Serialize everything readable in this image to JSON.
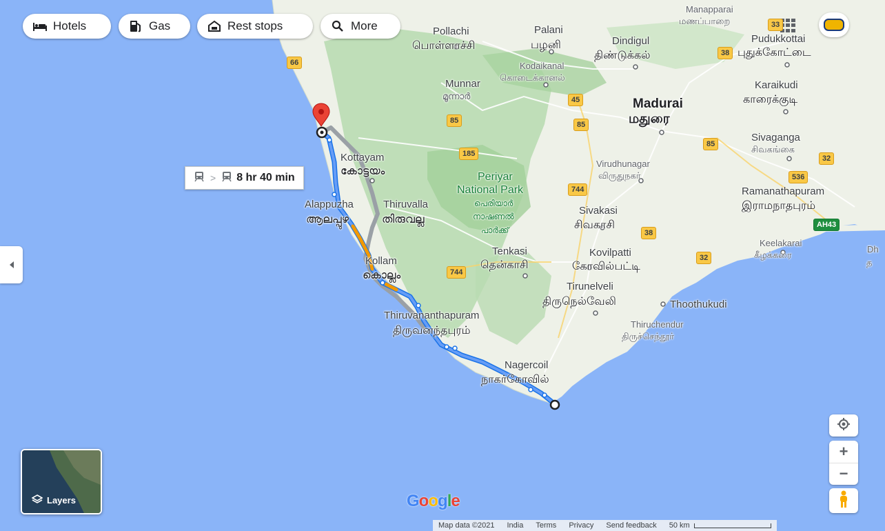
{
  "filters": {
    "hotels": "Hotels",
    "gas": "Gas",
    "rest_stops": "Rest stops",
    "more": "More"
  },
  "route": {
    "travel_time": "8 hr 40 min",
    "mode_icon": "train-icon"
  },
  "places": {
    "manapparai_en": "Manapparai",
    "manapparai_ta": "மணப்பாறை",
    "pollachi_en": "Pollachi",
    "pollachi_ta": "பொள்ளாச்சி",
    "palani_en": "Palani",
    "palani_ta": "பழனி",
    "dindigul_en": "Dindigul",
    "dindigul_ta": "திண்டுக்கல்",
    "pudukkottai_en": "Pudukkottai",
    "pudukkottai_ta": "புதுக்கோட்டை",
    "kodaikanal_en": "Kodaikanal",
    "kodaikanal_ta": "கொடைக்கானல்",
    "munnar_en": "Munnar",
    "munnar_ml": "മൂന്നാർ",
    "karaikudi_en": "Karaikudi",
    "karaikudi_ta": "காரைக்குடி",
    "madurai_en": "Madurai",
    "madurai_ta": "மதுரை",
    "sivaganga_en": "Sivaganga",
    "sivaganga_ta": "சிவகங்கை",
    "kottayam_en": "Kottayam",
    "kottayam_ml": "കോട്ടയം",
    "periyar_en": "Periyar",
    "national_park_en": "National Park",
    "periyar_ml1": "പെരിയാർ",
    "periyar_ml2": "നാഷണൽ",
    "periyar_ml3": "പാർക്ക്",
    "virudhunagar_en": "Virudhunagar",
    "virudhunagar_ta": "விருதுநகர்",
    "ramanathapuram_en": "Ramanathapuram",
    "ramanathapuram_ta": "இராமநாதபுரம்",
    "alappuzha_en": "Alappuzha",
    "alappuzha_ml": "ആലപ്പുഴ",
    "thiruvalla_en": "Thiruvalla",
    "thiruvalla_ml": "തിരുവല്ല",
    "sivakasi_en": "Sivakasi",
    "sivakasi_ta": "சிவகாசி",
    "tenkasi_en": "Tenkasi",
    "tenkasi_ta": "தென்காசி",
    "kovilpatti_en": "Kovilpatti",
    "kovilpatti_ta": "கோவில்பட்டி",
    "keelakarai_en": "Keelakarai",
    "keelakarai_ta": "கீழக்கரை",
    "kollam_en": "Kollam",
    "kollam_ml": "കൊല്ലം",
    "tirunelveli_en": "Tirunelveli",
    "tirunelveli_ta": "திருநெல்வேலி",
    "thoothukudi_en": "Thoothukudi",
    "thiruvananthapuram_en": "Thiruvananthapuram",
    "thiruvananthapuram_ta": "திருவனந்தபுரம்",
    "thiruchendur_en": "Thiruchendur",
    "thiruchendur_ta": "திருச்செந்தூர்",
    "nagercoil_en": "Nagercoil",
    "nagercoil_ta": "நாகர்கோவில்",
    "edge_dh": "Dh",
    "edge_ta": "த"
  },
  "highways": {
    "h66": "66",
    "h85a": "85",
    "h85b": "85",
    "h85c": "85",
    "h45": "45",
    "h38a": "38",
    "h38b": "38",
    "h185": "185",
    "h744a": "744",
    "h744b": "744",
    "h536": "536",
    "h32a": "32",
    "h32b": "32",
    "h33": "33",
    "ah43": "AH43"
  },
  "controls": {
    "layers": "Layers",
    "zoom_in": "+",
    "zoom_out": "−"
  },
  "logo": "Google",
  "attribution": {
    "map_data": "Map data ©2021",
    "country": "India",
    "terms": "Terms",
    "privacy": "Privacy",
    "feedback": "Send feedback",
    "scale": "50 km"
  },
  "colors": {
    "water": "#8ab4f8",
    "land": "#e8eee3",
    "forest": "#b8d9b0",
    "route_primary": "#4285f4",
    "route_alt": "#9e9e9e",
    "traffic": "#f29900",
    "pin": "#ea4335"
  }
}
